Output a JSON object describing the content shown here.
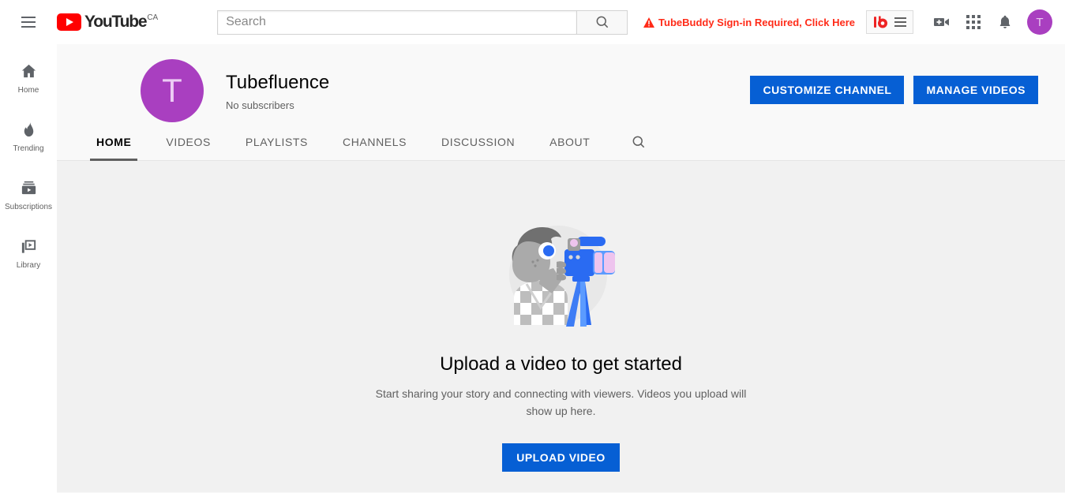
{
  "masthead": {
    "menu_icon": "hamburger-icon",
    "logo_text": "YouTube",
    "country_code": "CA",
    "search": {
      "value": "",
      "placeholder": "Search",
      "button_icon": "search-icon"
    },
    "tubebuddy_alert": {
      "icon": "warning-triangle-icon",
      "text": "TubeBuddy Sign-in Required, Click Here"
    },
    "tubebuddy_extension": {
      "logo_text": "tb",
      "menu_icon": "hamburger-icon"
    },
    "create_video_icon": "video-camera-plus-icon",
    "apps_icon": "apps-grid-icon",
    "notifications_icon": "bell-icon",
    "account_avatar_letter": "T"
  },
  "sidebar": {
    "items": [
      {
        "label": "Home",
        "icon": "home-icon"
      },
      {
        "label": "Trending",
        "icon": "flame-icon"
      },
      {
        "label": "Subscriptions",
        "icon": "subscriptions-icon"
      },
      {
        "label": "Library",
        "icon": "library-icon"
      }
    ]
  },
  "channel": {
    "avatar_letter": "T",
    "name": "Tubefluence",
    "subscribers": "No subscribers",
    "customize_label": "CUSTOMIZE CHANNEL",
    "manage_label": "MANAGE VIDEOS",
    "tabs": [
      {
        "label": "HOME",
        "active": true
      },
      {
        "label": "VIDEOS",
        "active": false
      },
      {
        "label": "PLAYLISTS",
        "active": false
      },
      {
        "label": "CHANNELS",
        "active": false
      },
      {
        "label": "DISCUSSION",
        "active": false
      },
      {
        "label": "ABOUT",
        "active": false
      }
    ],
    "tab_search_icon": "search-icon"
  },
  "empty_state": {
    "illustration": "person-with-camcorder-illustration",
    "title": "Upload a video to get started",
    "subtitle": "Start sharing your story and connecting with viewers. Videos you upload will show up here.",
    "upload_label": "UPLOAD VIDEO"
  },
  "colors": {
    "youtube_red": "#ff0000",
    "accent_blue": "#065fd4",
    "avatar_purple": "#a93fc0",
    "alert_red": "#ff2b18",
    "page_bg": "#f9f9f9",
    "empty_bg": "#f1f1f1"
  }
}
